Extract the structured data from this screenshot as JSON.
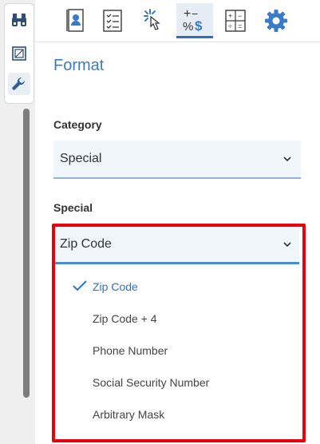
{
  "panel": {
    "title": "Format"
  },
  "category": {
    "label": "Category",
    "value": "Special"
  },
  "special": {
    "label": "Special",
    "value": "Zip Code",
    "options": [
      {
        "label": "Zip Code",
        "selected": true
      },
      {
        "label": "Zip Code + 4",
        "selected": false
      },
      {
        "label": "Phone Number",
        "selected": false
      },
      {
        "label": "Social Security Number",
        "selected": false
      },
      {
        "label": "Arbitrary Mask",
        "selected": false
      }
    ]
  },
  "toolbar": {
    "tabs": [
      {
        "icon": "contacts-book-icon"
      },
      {
        "icon": "checklist-icon"
      },
      {
        "icon": "touch-click-icon"
      },
      {
        "icon": "number-format-icon",
        "active": true
      },
      {
        "icon": "calculator-icon"
      },
      {
        "icon": "gear-icon"
      }
    ]
  },
  "colors": {
    "accent": "#3b7cc4",
    "highlight_outline": "#e8000b"
  }
}
